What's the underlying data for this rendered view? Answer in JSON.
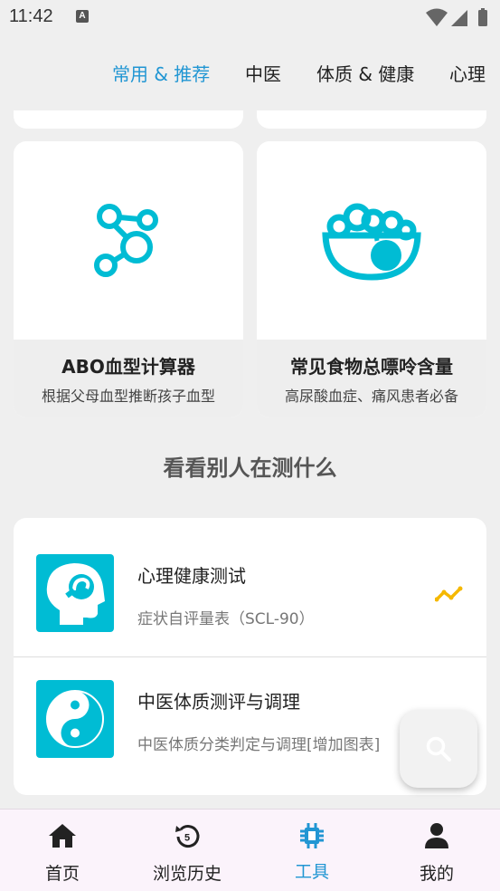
{
  "status_bar": {
    "time": "11:42",
    "notif": "A"
  },
  "top_tabs": [
    {
      "label": "常用 & 推荐",
      "active": true
    },
    {
      "label": "中医",
      "active": false
    },
    {
      "label": "体质 & 健康",
      "active": false
    },
    {
      "label": "心理",
      "active": false
    }
  ],
  "tool_cards": [
    {
      "title": "ABO血型计算器",
      "subtitle": "根据父母血型推断孩子血型",
      "icon": "molecule-icon"
    },
    {
      "title": "常见食物总嘌呤含量",
      "subtitle": "高尿酸血症、痛风患者必备",
      "icon": "food-bowl-icon"
    }
  ],
  "section_title": "看看别人在测什么",
  "test_list": [
    {
      "name": "心理健康测试",
      "desc": "症状自评量表（SCL-90）",
      "icon": "head-icon",
      "trending": true
    },
    {
      "name": "中医体质测评与调理",
      "desc": "中医体质分类判定与调理[增加图表]",
      "icon": "yin-yang-icon",
      "trending": false
    }
  ],
  "colors": {
    "accent": "#2196d3",
    "brand_cyan": "#00bcd4",
    "trend": "#f5b800"
  },
  "bottom_nav": [
    {
      "label": "首页",
      "icon": "home-icon",
      "active": false
    },
    {
      "label": "浏览历史",
      "icon": "history-icon",
      "active": false
    },
    {
      "label": "工具",
      "icon": "tools-icon",
      "active": true
    },
    {
      "label": "我的",
      "icon": "person-icon",
      "active": false
    }
  ],
  "history_badge": "5"
}
